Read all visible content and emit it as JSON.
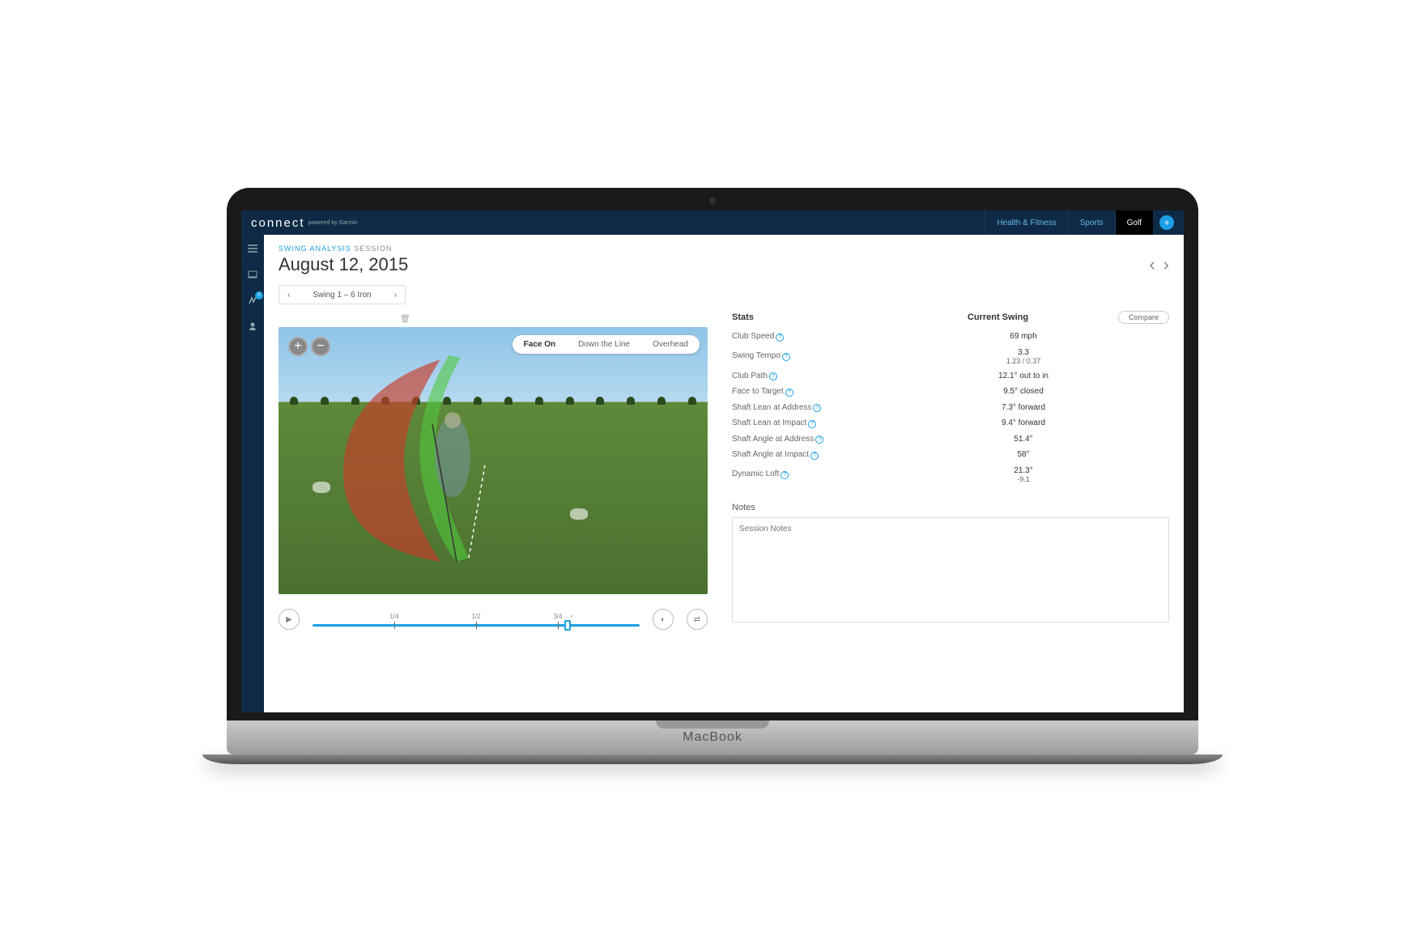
{
  "brand": {
    "name": "connect",
    "tagline": "powered by Garmin"
  },
  "topnav": {
    "health": "Health & Fitness",
    "sports": "Sports",
    "golf": "Golf"
  },
  "breadcrumb": {
    "section": "SWING ANALYSIS",
    "sub": "SESSION"
  },
  "page_title": "August 12, 2015",
  "swing_selector": "Swing 1 – 6 Iron",
  "view_tabs": {
    "face_on": "Face On",
    "down_line": "Down the Line",
    "overhead": "Overhead"
  },
  "timeline": {
    "q1": "1/4",
    "q2": "1/2",
    "q3": "3/4"
  },
  "stats_header": {
    "stats": "Stats",
    "current": "Current Swing",
    "compare": "Compare"
  },
  "stats": [
    {
      "label": "Club Speed",
      "value": "69 mph"
    },
    {
      "label": "Swing Tempo",
      "value": "3.3",
      "sub": "1.23 / 0.37"
    },
    {
      "label": "Club Path",
      "value": "12.1° out to in"
    },
    {
      "label": "Face to Target",
      "value": "9.5° closed"
    },
    {
      "label": "Shaft Lean at Address",
      "value": "7.3° forward"
    },
    {
      "label": "Shaft Lean at Impact",
      "value": "9.4° forward"
    },
    {
      "label": "Shaft Angle at Address",
      "value": "51.4°"
    },
    {
      "label": "Shaft Angle at Impact",
      "value": "58°"
    },
    {
      "label": "Dynamic Loft",
      "value": "21.3°",
      "sub": "-9.1"
    }
  ],
  "notes": {
    "label": "Notes",
    "placeholder": "Session Notes"
  },
  "laptop_brand": "MacBook",
  "sidebar_badge": "0"
}
